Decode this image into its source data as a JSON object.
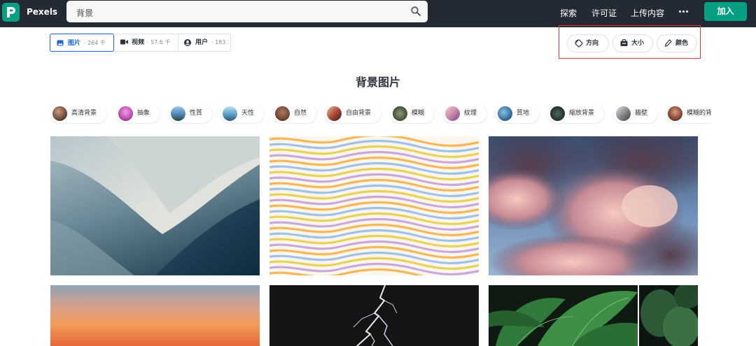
{
  "header": {
    "brand": "Pexels",
    "search_value": "背景",
    "nav": [
      "探索",
      "许可证",
      "上传内容"
    ],
    "join_label": "加入",
    "colors": {
      "bar": "#232a34",
      "accent": "#05a081"
    }
  },
  "tabs": [
    {
      "label": "图片",
      "count": "· 264 千",
      "icon": "image-icon",
      "active": true
    },
    {
      "label": "视频",
      "count": "· 57.6 千",
      "icon": "video-icon",
      "active": false
    },
    {
      "label": "用户",
      "count": "· 183",
      "icon": "user-icon",
      "active": false
    }
  ],
  "filters": [
    {
      "label": "方向",
      "icon": "orientation-icon"
    },
    {
      "label": "大小",
      "icon": "size-icon"
    },
    {
      "label": "颜色",
      "icon": "color-picker-icon"
    }
  ],
  "page_title": "背景图片",
  "categories": [
    {
      "label": "高清背景",
      "color": "#6b4a3a"
    },
    {
      "label": "抽象",
      "color": "#c34fb4"
    },
    {
      "label": "性質",
      "color": "#4b86b8"
    },
    {
      "label": "天性",
      "color": "#5aa0c8"
    },
    {
      "label": "自然",
      "color": "#7a4d3a"
    },
    {
      "label": "自由背景",
      "color": "#b04a3a"
    },
    {
      "label": "模糊",
      "color": "#4a5a3a"
    },
    {
      "label": "紋理",
      "color": "#c88aa8"
    },
    {
      "label": "質地",
      "color": "#3a78a8"
    },
    {
      "label": "縮放背景",
      "color": "#2a3a38"
    },
    {
      "label": "牆壁",
      "color": "#8a8a90"
    },
    {
      "label": "模糊的背",
      "color": "#8a4a3a"
    }
  ]
}
